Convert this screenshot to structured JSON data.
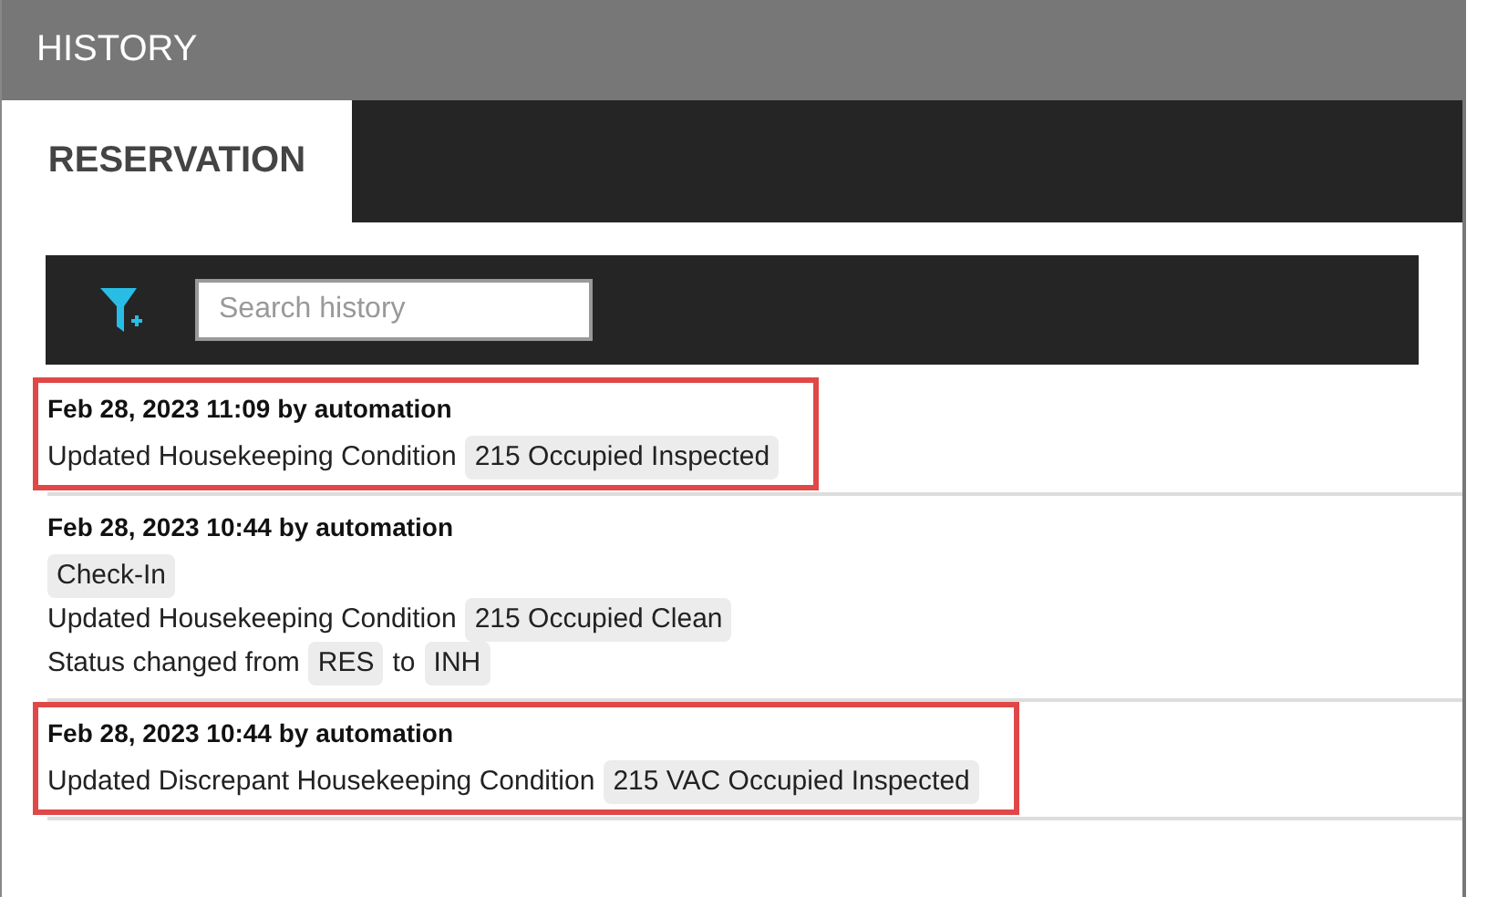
{
  "header": {
    "title": "HISTORY"
  },
  "tabs": [
    {
      "label": "RESERVATION",
      "selected": true
    }
  ],
  "search": {
    "placeholder": "Search history"
  },
  "entries": [
    {
      "heading": "Feb 28, 2023 11:09 by automation",
      "highlighted": true,
      "lines": [
        [
          {
            "kind": "text",
            "text": "Updated Housekeeping Condition"
          },
          {
            "kind": "tag",
            "text": "215 Occupied Inspected"
          }
        ]
      ]
    },
    {
      "heading": "Feb 28, 2023 10:44 by automation",
      "highlighted": false,
      "lines": [
        [
          {
            "kind": "tag",
            "text": "Check-In"
          }
        ],
        [
          {
            "kind": "text",
            "text": "Updated Housekeeping Condition"
          },
          {
            "kind": "tag",
            "text": "215 Occupied Clean"
          }
        ],
        [
          {
            "kind": "text",
            "text": "Status changed from"
          },
          {
            "kind": "tag",
            "text": "RES"
          },
          {
            "kind": "text",
            "text": "to"
          },
          {
            "kind": "tag",
            "text": "INH"
          }
        ]
      ]
    },
    {
      "heading": "Feb 28, 2023 10:44 by automation",
      "highlighted": true,
      "lines": [
        [
          {
            "kind": "text",
            "text": "Updated Discrepant Housekeeping Condition"
          },
          {
            "kind": "tag",
            "text": "215 VAC Occupied Inspected"
          }
        ]
      ]
    }
  ]
}
